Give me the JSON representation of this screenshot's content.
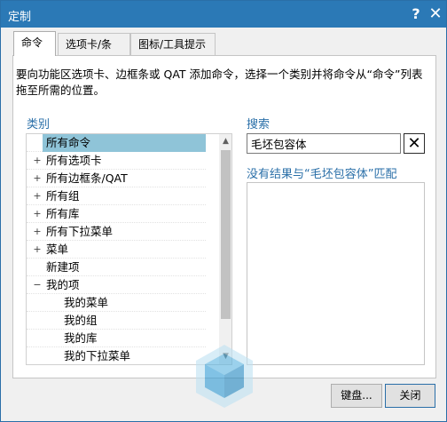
{
  "window": {
    "title": "定制",
    "help": "?",
    "close": "✕"
  },
  "tabs": [
    "命令",
    "选项卡/条",
    "图标/工具提示"
  ],
  "description": "要向功能区选项卡、边框条或 QAT 添加命令，选择一个类别并将命令从“命令”列表拖至所需的位置。",
  "category": {
    "label": "类别",
    "items": [
      {
        "label": "所有命令",
        "expander": "",
        "selected": true,
        "child": false
      },
      {
        "label": "所有选项卡",
        "expander": "+",
        "selected": false,
        "child": false
      },
      {
        "label": "所有边框条/QAT",
        "expander": "+",
        "selected": false,
        "child": false
      },
      {
        "label": "所有组",
        "expander": "+",
        "selected": false,
        "child": false
      },
      {
        "label": "所有库",
        "expander": "+",
        "selected": false,
        "child": false
      },
      {
        "label": "所有下拉菜单",
        "expander": "+",
        "selected": false,
        "child": false
      },
      {
        "label": "菜单",
        "expander": "+",
        "selected": false,
        "child": false
      },
      {
        "label": "新建项",
        "expander": "",
        "selected": false,
        "child": false
      },
      {
        "label": "我的项",
        "expander": "−",
        "selected": false,
        "child": false
      },
      {
        "label": "我的菜单",
        "expander": "",
        "selected": false,
        "child": true
      },
      {
        "label": "我的组",
        "expander": "",
        "selected": false,
        "child": true
      },
      {
        "label": "我的库",
        "expander": "",
        "selected": false,
        "child": true
      },
      {
        "label": "我的下拉菜单",
        "expander": "",
        "selected": false,
        "child": true
      }
    ]
  },
  "search": {
    "label": "搜索",
    "value": "毛坯包容体",
    "clear_icon": "✕",
    "no_result": "没有结果与“毛坯包容体”匹配"
  },
  "buttons": {
    "keyboard": "键盘...",
    "close": "关闭"
  },
  "scroll": {
    "up": "▲",
    "down": "▼"
  },
  "colors": {
    "titlebar": "#2b79b6",
    "accent": "#2a6fa8",
    "selection": "#8fc4d8"
  }
}
